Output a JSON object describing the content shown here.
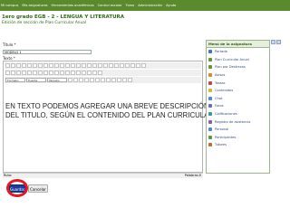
{
  "nav": {
    "items": [
      "Mi campus",
      "Mis asignaturas",
      "Herramientas académicas",
      "Control escolar",
      "Foros",
      "Administración",
      "Ayuda"
    ]
  },
  "course_title": "1ero grado EGB - 2 - LENGUA Y LITERATURA",
  "edit_title": "Edición de sección de Plan Curricular Anual",
  "title_label": "Título *",
  "title_value": "MODELO 1",
  "text_label": "Texto *",
  "toolbar": {
    "format_select": "Formato",
    "font_select": "Fuente",
    "size_select": "Tamaño"
  },
  "editor_text": {
    "line1": "EN TEXTO PODEMOS AGREGAR UNA BREVE DESCRIPCIÓN",
    "line2": "DEL TITULO, SEGÚN EL CONTENIDO DEL PLAN CURRICULAR"
  },
  "status": {
    "ruta": "Ruta:",
    "words": "Palabras:0"
  },
  "panel": {
    "title": "Menú de la asignatura",
    "items": [
      {
        "label": "Portada",
        "icon": "home-icon",
        "color": "#3b77c8"
      },
      {
        "label": "Plan Curricular Anual",
        "icon": "document-icon",
        "color": "#5a9a3a"
      },
      {
        "label": "Plan por Destrezas",
        "icon": "document-icon",
        "color": "#5a9a3a"
      },
      {
        "label": "Avisos",
        "icon": "announcement-icon",
        "color": "#d38a2a"
      },
      {
        "label": "Tareas",
        "icon": "task-icon",
        "color": "#b84a4a"
      },
      {
        "label": "Contenidos",
        "icon": "folder-icon",
        "color": "#d9b33a"
      },
      {
        "label": "Chat",
        "icon": "chat-icon",
        "color": "#4a8ad0"
      },
      {
        "label": "Foros",
        "icon": "forum-icon",
        "color": "#6a6ac0"
      },
      {
        "label": "Calificaciones",
        "icon": "grades-icon",
        "color": "#3a9a8a"
      },
      {
        "label": "Registro de asistencia",
        "icon": "attendance-icon",
        "color": "#8a5ab0"
      },
      {
        "label": "Personal",
        "icon": "user-icon",
        "color": "#4a8ad0"
      },
      {
        "label": "Participantes",
        "icon": "group-icon",
        "color": "#5a9a3a"
      },
      {
        "label": "Tutores",
        "icon": "tutor-icon",
        "color": "#c06a3a"
      }
    ]
  },
  "buttons": {
    "save": "Guardar",
    "cancel": "Cancelar"
  },
  "colors": {
    "nav_bg": "#5a8a2c",
    "highlight": "#e8161d",
    "save_bg": "#1c3c9a"
  }
}
